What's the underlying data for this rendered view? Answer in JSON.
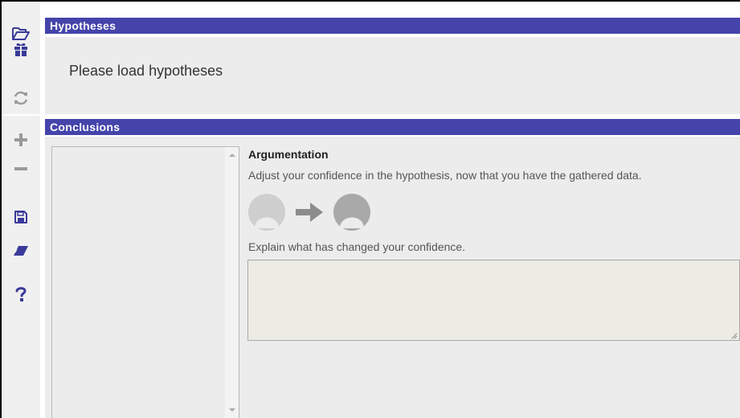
{
  "toolbar": {
    "items": [
      {
        "name": "open-folder-icon",
        "color": "#3a3a9a"
      },
      {
        "name": "gift-icon",
        "color": "#3a3a9a"
      },
      {
        "name": "refresh-icon",
        "color": "#9a9a9a"
      },
      {
        "name": "plus-icon",
        "color": "#9a9a9a"
      },
      {
        "name": "minus-icon",
        "color": "#9a9a9a"
      },
      {
        "name": "save-icon",
        "color": "#3a3a9a"
      },
      {
        "name": "eraser-icon",
        "color": "#3a3a9a"
      },
      {
        "name": "help-icon",
        "color": "#3a3a9a"
      }
    ]
  },
  "hypotheses": {
    "title": "Hypotheses",
    "message": "Please load hypotheses"
  },
  "conclusions": {
    "title": "Conclusions",
    "argumentation_title": "Argumentation",
    "argumentation_desc": "Adjust your confidence in the hypothesis, now that you have the gathered data.",
    "explain_label": "Explain what has changed your confidence.",
    "explain_value": ""
  },
  "colors": {
    "header_bg": "#4444aa",
    "header_text": "#ffffff",
    "panel_bg": "#ececec",
    "confidence_gray": "#bdbdbd",
    "arrow_gray": "#8c8c8c"
  }
}
